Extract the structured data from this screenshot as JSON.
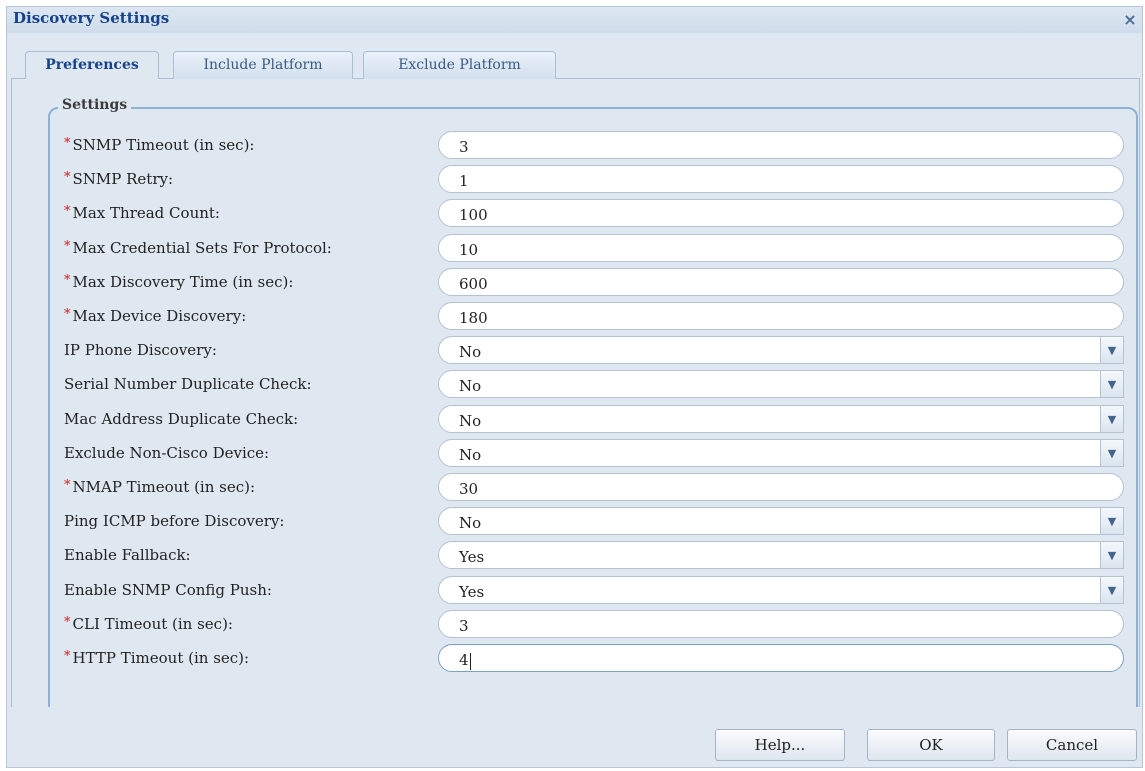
{
  "dialog": {
    "title": "Discovery Settings",
    "close_glyph": "×"
  },
  "tabs": [
    {
      "label": "Preferences",
      "active": true
    },
    {
      "label": "Include Platform",
      "active": false
    },
    {
      "label": "Exclude Platform",
      "active": false
    }
  ],
  "settings": {
    "legend": "Settings",
    "fields": [
      {
        "label": "SNMP Timeout (in sec):",
        "value": "3",
        "required": true,
        "type": "text"
      },
      {
        "label": "SNMP Retry:",
        "value": "1",
        "required": true,
        "type": "text"
      },
      {
        "label": "Max Thread Count:",
        "value": "100",
        "required": true,
        "type": "text"
      },
      {
        "label": "Max Credential Sets For Protocol:",
        "value": "10",
        "required": true,
        "type": "text"
      },
      {
        "label": "Max Discovery Time (in sec):",
        "value": "600",
        "required": true,
        "type": "text"
      },
      {
        "label": "Max Device Discovery:",
        "value": "180",
        "required": true,
        "type": "text"
      },
      {
        "label": "IP Phone Discovery:",
        "value": "No",
        "required": false,
        "type": "select"
      },
      {
        "label": "Serial Number Duplicate Check:",
        "value": "No",
        "required": false,
        "type": "select"
      },
      {
        "label": "Mac Address Duplicate Check:",
        "value": "No",
        "required": false,
        "type": "select"
      },
      {
        "label": "Exclude Non-Cisco Device:",
        "value": "No",
        "required": false,
        "type": "select"
      },
      {
        "label": "NMAP Timeout (in sec):",
        "value": "30",
        "required": true,
        "type": "text"
      },
      {
        "label": "Ping ICMP before Discovery:",
        "value": "No",
        "required": false,
        "type": "select"
      },
      {
        "label": "Enable Fallback:",
        "value": "Yes",
        "required": false,
        "type": "select"
      },
      {
        "label": "Enable SNMP Config Push:",
        "value": "Yes",
        "required": false,
        "type": "select"
      },
      {
        "label": "CLI Timeout (in sec):",
        "value": "3",
        "required": true,
        "type": "text"
      },
      {
        "label": "HTTP Timeout (in sec):",
        "value": "4",
        "required": true,
        "type": "text",
        "focused": true
      }
    ]
  },
  "buttons": {
    "help": "Help...",
    "ok": "OK",
    "cancel": "Cancel"
  },
  "icons": {
    "required_marker": "*",
    "dropdown_arrow": "▼"
  },
  "colors": {
    "title": "#15428b",
    "required": "#cc2222",
    "panel_bg": "#dfe8f1"
  }
}
